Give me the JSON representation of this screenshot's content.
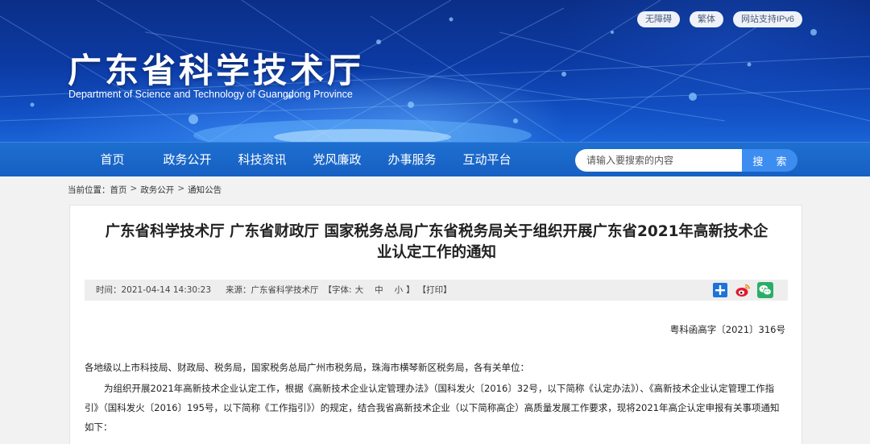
{
  "header": {
    "title": "广东省科学技术厅",
    "subtitle": "Department of Science and Technology of Guangdong Province",
    "top_links": [
      "无障碍",
      "繁体",
      "网站支持IPv6"
    ]
  },
  "nav": {
    "items": [
      "首页",
      "政务公开",
      "科技资讯",
      "党风廉政",
      "办事服务",
      "互动平台"
    ],
    "search_placeholder": "请输入要搜索的内容",
    "search_button": "搜 索"
  },
  "breadcrumb": {
    "label": "当前位置：",
    "items": [
      "首页",
      "政务公开",
      "通知公告"
    ],
    "separator": ">"
  },
  "article": {
    "title_line1": "广东省科学技术厅 广东省财政厅 国家税务总局广东省税务局关于组织开展广东省2021年高新技术企",
    "title_line2": "业认定工作的通知",
    "meta": {
      "time": "时间：2021-04-14 14:30:23",
      "source": "来源：广东省科学技术厅",
      "font_label": "【字体:",
      "font_sizes": [
        "大",
        "中",
        "小"
      ],
      "font_close": "】",
      "print": "【打印】"
    },
    "share_icons": [
      "plus-share-icon",
      "weibo-icon",
      "wechat-icon"
    ],
    "doc_number": "粤科函高字〔2021〕316号",
    "addressee": "各地级以上市科技局、财政局、税务局，国家税务总局广州市税务局，珠海市横琴新区税务局，各有关单位：",
    "paragraph1": "为组织开展2021年高新技术企业认定工作，根据《高新技术企业认定管理办法》（国科发火〔2016〕32号，以下简称《认定办法》）、《高新技术企业认定管理工作指引》（国科发火〔2016〕195号，以下简称《工作指引》）的规定，结合我省高新技术企业（以下简称高企）高质量发展工作要求，现将2021年高企认定申报有关事项通知如下："
  }
}
